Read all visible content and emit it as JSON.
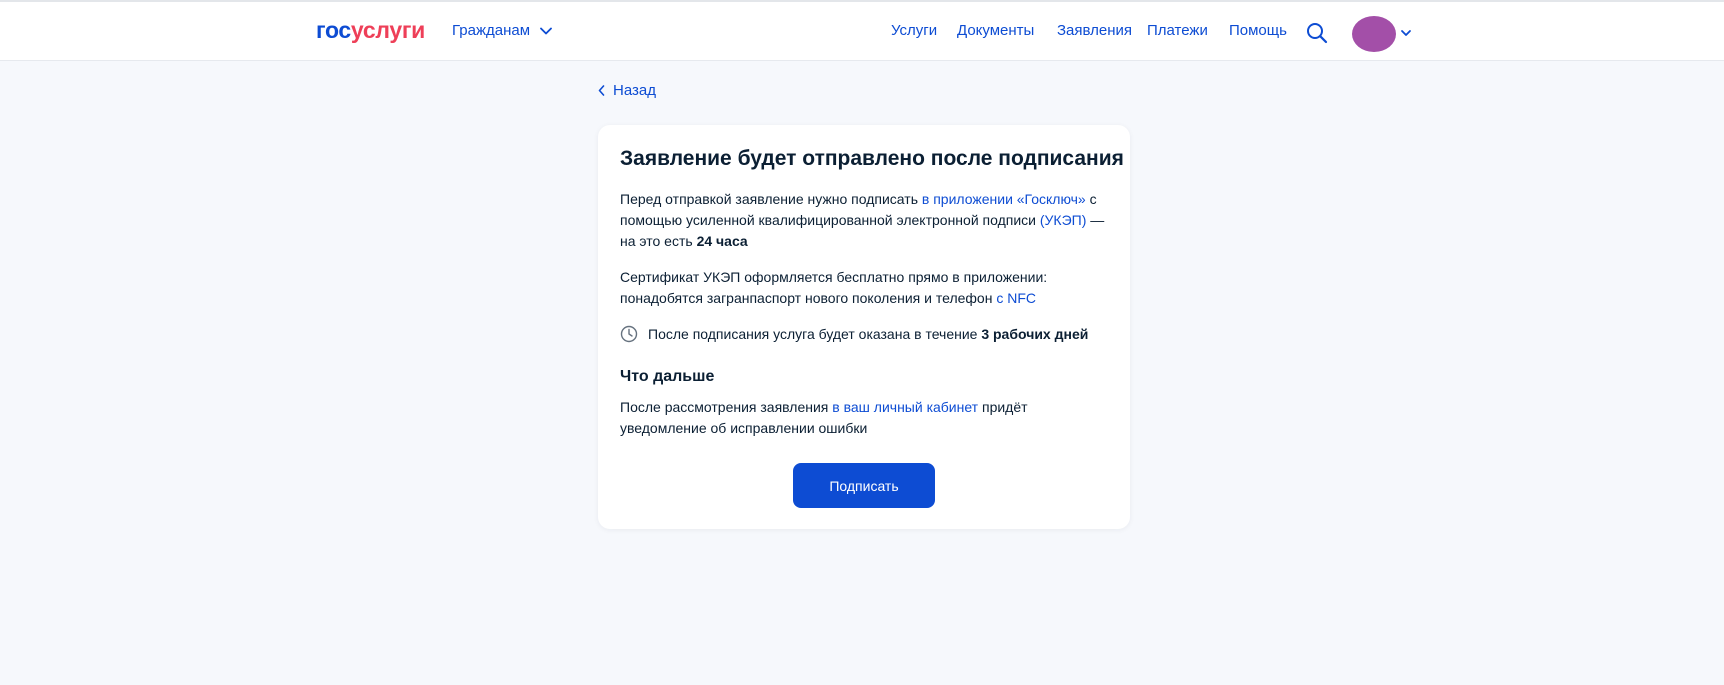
{
  "header": {
    "logo_part1": "гос",
    "logo_part2": "услуги",
    "citizens_label": "Гражданам",
    "nav": [
      "Услуги",
      "Документы",
      "Заявления",
      "Платежи",
      "Помощь"
    ],
    "icons": [
      "search-icon",
      "chevron-down-icon",
      "avatar"
    ]
  },
  "back_label": "Назад",
  "card": {
    "title": "Заявление будет отправлено после подписания",
    "p1": {
      "t1": "Перед отправкой заявление нужно подписать ",
      "link1": "в приложении «Госключ»",
      "t2": " с помощью усиленной квалифицированной электронной подписи ",
      "link2": "(УКЭП)",
      "t3": " — на это есть ",
      "bold": "24 часа"
    },
    "p2": {
      "t1": "Сертификат УКЭП оформляется бесплатно прямо в приложении: понадобятся загранпаспорт нового поколения и телефон ",
      "link": "с NFC"
    },
    "info": {
      "text": "После подписания услуга будет оказана в течение ",
      "bold": "3 рабочих дней"
    },
    "next_title": "Что дальше",
    "p3": {
      "t1": "После рассмотрения заявления ",
      "link": "в ваш личный кабинет",
      "t2": " придёт уведомление об исправлении ошибки"
    },
    "button_label": "Подписать"
  },
  "colors": {
    "accent": "#0d4cd3",
    "logo_red": "#ee3f58",
    "background": "#f6f8fc",
    "avatar": "#a34fa8"
  }
}
